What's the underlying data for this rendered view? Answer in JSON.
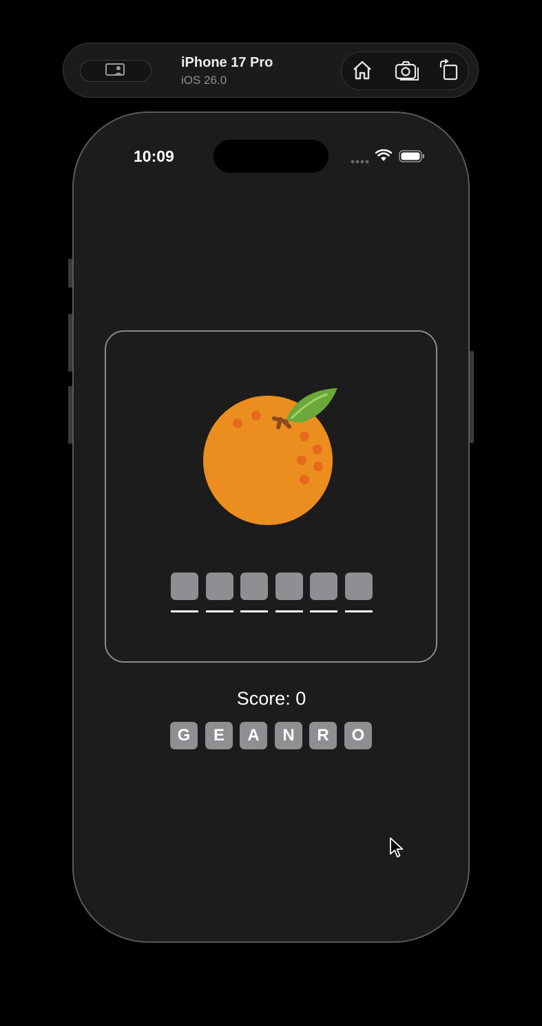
{
  "simulator": {
    "device_name": "iPhone 17 Pro",
    "os_version": "iOS 26.0",
    "icons": [
      "screen-share-icon",
      "home-icon",
      "screenshot-icon",
      "rotate-icon"
    ]
  },
  "status_bar": {
    "time": "10:09",
    "icons": [
      "cellular-dots-icon",
      "wifi-icon",
      "battery-icon"
    ]
  },
  "game": {
    "picture": "orange",
    "answer_slot_count": 6,
    "score_text": "Score: 0",
    "letters": [
      "G",
      "E",
      "A",
      "N",
      "R",
      "O"
    ]
  },
  "colors": {
    "background": "#000000",
    "screen": "#1c1c1c",
    "tile": "#8e8e93",
    "orange": "#ec8d20",
    "leaf": "#6aa83a"
  }
}
